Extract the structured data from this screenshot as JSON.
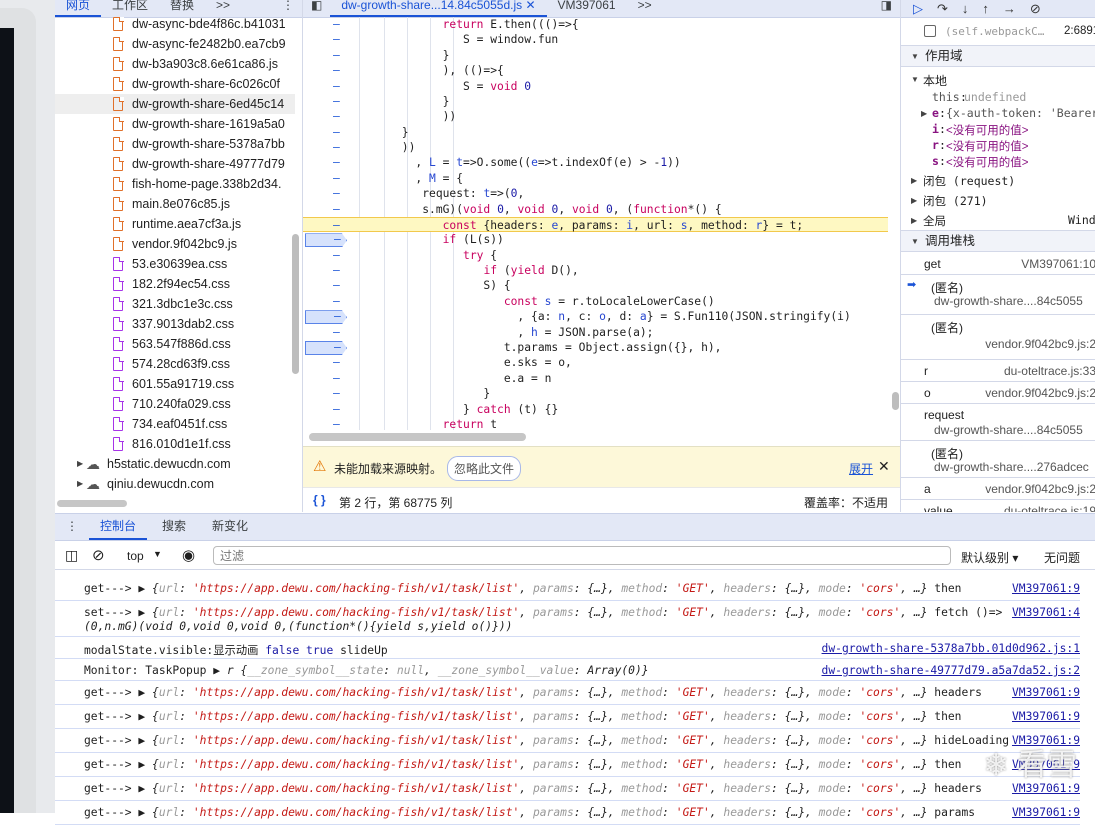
{
  "navigator": {
    "tabs": [
      "网页",
      "工作区",
      "替换"
    ],
    "more": ">>",
    "files": [
      {
        "name": "dw-async-bde4f86c.b41031",
        "type": "js"
      },
      {
        "name": "dw-async-fe2482b0.ea7cb9",
        "type": "js"
      },
      {
        "name": "dw-b3a903c8.6e61ca86.js",
        "type": "js"
      },
      {
        "name": "dw-growth-share-6c026c0f",
        "type": "js"
      },
      {
        "name": "dw-growth-share-6ed45c14",
        "type": "js",
        "selected": true
      },
      {
        "name": "dw-growth-share-1619a5a0",
        "type": "js"
      },
      {
        "name": "dw-growth-share-5378a7bb",
        "type": "js"
      },
      {
        "name": "dw-growth-share-49777d79",
        "type": "js"
      },
      {
        "name": "fish-home-page.338b2d34.",
        "type": "js"
      },
      {
        "name": "main.8e076c85.js",
        "type": "js"
      },
      {
        "name": "runtime.aea7cf3a.js",
        "type": "js"
      },
      {
        "name": "vendor.9f042bc9.js",
        "type": "js"
      },
      {
        "name": "53.e30639ea.css",
        "type": "css"
      },
      {
        "name": "182.2f94ec54.css",
        "type": "css"
      },
      {
        "name": "321.3dbc1e3c.css",
        "type": "css"
      },
      {
        "name": "337.9013dab2.css",
        "type": "css"
      },
      {
        "name": "563.547f886d.css",
        "type": "css"
      },
      {
        "name": "574.28cd63f9.css",
        "type": "css"
      },
      {
        "name": "601.55a91719.css",
        "type": "css"
      },
      {
        "name": "710.240fa029.css",
        "type": "css"
      },
      {
        "name": "734.eaf0451f.css",
        "type": "css"
      },
      {
        "name": "816.010d1e1f.css",
        "type": "css"
      }
    ],
    "domains": [
      "h5static.dewucdn.com",
      "qiniu.dewucdn.com"
    ]
  },
  "editor": {
    "tabs": [
      {
        "label": "dw-growth-share...14.84c5055d.js",
        "active": true
      },
      {
        "label": "VM397061"
      }
    ],
    "more": ">>",
    "lines": [
      {
        "t": [
          [
            "            "
          ],
          [
            "return",
            "k"
          ],
          [
            " E.then((()=>{"
          ]
        ]
      },
      {
        "t": [
          [
            "               S = window.fun"
          ]
        ]
      },
      {
        "t": [
          [
            "            }"
          ]
        ]
      },
      {
        "t": [
          [
            "            ), (()=>{"
          ]
        ]
      },
      {
        "t": [
          [
            "               S = "
          ],
          [
            "void",
            "k"
          ],
          [
            " "
          ],
          [
            "0",
            "n"
          ]
        ]
      },
      {
        "t": [
          [
            "            }"
          ]
        ]
      },
      {
        "t": [
          [
            "            ))"
          ]
        ]
      },
      {
        "t": [
          [
            "      }"
          ]
        ]
      },
      {
        "t": [
          [
            "      ))"
          ]
        ]
      },
      {
        "t": [
          [
            "        , "
          ],
          [
            "L",
            "v"
          ],
          [
            " = "
          ],
          [
            "t",
            "v"
          ],
          [
            "=>O.some(("
          ],
          [
            "e",
            "v"
          ],
          [
            "=>t.indexOf(e) > -"
          ],
          [
            "1",
            "n"
          ],
          [
            "))"
          ]
        ]
      },
      {
        "t": [
          [
            "        , "
          ],
          [
            "M",
            "v"
          ],
          [
            " = {"
          ]
        ]
      },
      {
        "t": [
          [
            "         request: "
          ],
          [
            "t",
            "v"
          ],
          [
            "=>("
          ],
          [
            "0",
            "n"
          ],
          [
            ","
          ]
        ]
      },
      {
        "t": [
          [
            "         s.mG)("
          ],
          [
            "void",
            "k"
          ],
          [
            " "
          ],
          [
            "0",
            "n"
          ],
          [
            ", "
          ],
          [
            "void",
            "k"
          ],
          [
            " "
          ],
          [
            "0",
            "n"
          ],
          [
            ", "
          ],
          [
            "void",
            "k"
          ],
          [
            " "
          ],
          [
            "0",
            "n"
          ],
          [
            ", ("
          ],
          [
            "function",
            "k"
          ],
          [
            "*() {"
          ]
        ]
      },
      {
        "t": [
          [
            "            "
          ],
          [
            "const",
            "k"
          ],
          [
            " {headers: "
          ],
          [
            "e",
            "v"
          ],
          [
            ", params: "
          ],
          [
            "i",
            "v"
          ],
          [
            ", url: "
          ],
          [
            "s",
            "v"
          ],
          [
            ", method: "
          ],
          [
            "r",
            "v"
          ],
          [
            "} = t;"
          ]
        ],
        "current": true
      },
      {
        "t": [
          [
            "            "
          ],
          [
            "if",
            "k"
          ],
          [
            " (L(s))"
          ]
        ],
        "bp": true
      },
      {
        "t": [
          [
            "               "
          ],
          [
            "try",
            "k"
          ],
          [
            " {"
          ]
        ]
      },
      {
        "t": [
          [
            "                  "
          ],
          [
            "if",
            "k"
          ],
          [
            " ("
          ],
          [
            "yield",
            "k"
          ],
          [
            " D(),"
          ]
        ]
      },
      {
        "t": [
          [
            "                  S) {"
          ]
        ]
      },
      {
        "t": [
          [
            "                     "
          ],
          [
            "const",
            "k"
          ],
          [
            " "
          ],
          [
            "s",
            "v"
          ],
          [
            " = r.toLocaleLowerCase()"
          ]
        ]
      },
      {
        "t": [
          [
            "                       , {a: "
          ],
          [
            "n",
            "v"
          ],
          [
            ", c: "
          ],
          [
            "o",
            "v"
          ],
          [
            ", d: "
          ],
          [
            "a",
            "v"
          ],
          [
            "} = S.Fun110(JSON.stringify(i)"
          ]
        ],
        "bp": true
      },
      {
        "t": [
          [
            "                       , "
          ],
          [
            "h",
            "v"
          ],
          [
            " = JSON.parse(a);"
          ]
        ]
      },
      {
        "t": [
          [
            "                     t.params = Object.assign({}, h),"
          ]
        ],
        "bp": true
      },
      {
        "t": [
          [
            "                     e.sks = o,"
          ]
        ]
      },
      {
        "t": [
          [
            "                     e.a = n"
          ]
        ]
      },
      {
        "t": [
          [
            "                  }"
          ]
        ]
      },
      {
        "t": [
          [
            "               } "
          ],
          [
            "catch",
            "k"
          ],
          [
            " (t) {}"
          ]
        ]
      },
      {
        "t": [
          [
            "            "
          ],
          [
            "return",
            "k"
          ],
          [
            " t"
          ]
        ]
      }
    ],
    "line_marker": "–",
    "warning": {
      "text": "未能加载来源映射。",
      "ignore_button": "忽略此文件",
      "expand_link": "展开",
      "close": "✕"
    },
    "status": {
      "position": "第 2 行，第 68775 列",
      "coverage": "覆盖率：不适用",
      "format_icon": "{ }"
    }
  },
  "debugger": {
    "breakpoint_item": {
      "label": "(self.webpackC…",
      "loc": "2:6891"
    },
    "scope_title": "作用域",
    "local_title": "本地",
    "local_vars": [
      {
        "name": "this",
        "value": "undefined"
      },
      {
        "name": "e",
        "value": "{x-auth-token: 'Bearer"
      },
      {
        "name": "i",
        "value": "<没有可用的值>"
      },
      {
        "name": "r",
        "value": "<没有可用的值>"
      },
      {
        "name": "s",
        "value": "<没有可用的值>"
      }
    ],
    "closures": [
      "闭包 (request)",
      "闭包 (271)"
    ],
    "global": {
      "label": "全局",
      "value": "Wind"
    },
    "callstack_title": "调用堆栈",
    "callstack": [
      {
        "fn": "get",
        "loc": "VM397061:10"
      },
      {
        "fn": "(匿名)",
        "loc": "dw-growth-share....84c5055",
        "current": true
      },
      {
        "fn": "(匿名)",
        "loc": "vendor.9f042bc9.js:2"
      },
      {
        "fn": "r",
        "loc": "du-oteltrace.js:33"
      },
      {
        "fn": "o",
        "loc": "vendor.9f042bc9.js:2"
      },
      {
        "fn": "request",
        "loc": "dw-growth-share....84c5055"
      },
      {
        "fn": "(匿名)",
        "loc": "dw-growth-share....276adcec"
      },
      {
        "fn": "a",
        "loc": "vendor.9f042bc9.js:2"
      },
      {
        "fn": "value",
        "loc": "du-oteltrace.js:19"
      }
    ]
  },
  "console": {
    "tabs": [
      "控制台",
      "搜索",
      "新变化"
    ],
    "context": "top",
    "filter_placeholder": "过滤",
    "level": "默认级别",
    "issues": "无问题",
    "url": "'https://app.dewu.com/hacking-fish/v1/task/list'",
    "messages": [
      {
        "prefix": "get--->",
        "kind": "obj",
        "suffix": "then",
        "src": "VM397061:9"
      },
      {
        "prefix": "set--->",
        "kind": "obj",
        "suffix": "fetch ()=>",
        "line2": "(0,n.mG)(void 0,void 0,void 0,(function*(){yield s,yield o()}))",
        "src": "VM397061:4"
      },
      {
        "prefix": "modalState.visible:显示动画",
        "kind": "bool",
        "suffix": "slideUp",
        "src": "dw-growth-share-5378a7bb.01d0d962.js:1"
      },
      {
        "prefix": "Monitor: TaskPopup",
        "kind": "zone",
        "src": "dw-growth-share-49777d79.a5a7da52.js:2"
      },
      {
        "prefix": "get--->",
        "kind": "obj",
        "suffix": "headers",
        "src": "VM397061:9"
      },
      {
        "prefix": "get--->",
        "kind": "obj",
        "suffix": "then",
        "src": "VM397061:9"
      },
      {
        "prefix": "get--->",
        "kind": "obj",
        "suffix": "hideLoading",
        "src": "VM397061:9"
      },
      {
        "prefix": "get--->",
        "kind": "obj",
        "suffix": "then",
        "src": "VM397061:9"
      },
      {
        "prefix": "get--->",
        "kind": "obj",
        "suffix": "headers",
        "src": "VM397061:9"
      },
      {
        "prefix": "get--->",
        "kind": "obj",
        "suffix": "params",
        "src": "VM397061:9"
      }
    ]
  },
  "watermark": "看雪",
  "colors": {
    "accent": "#1a53d6",
    "keyword": "#c8005e",
    "string": "#c41a16",
    "highlight": "#fef8c2",
    "tabbar": "#e3e8f6"
  }
}
